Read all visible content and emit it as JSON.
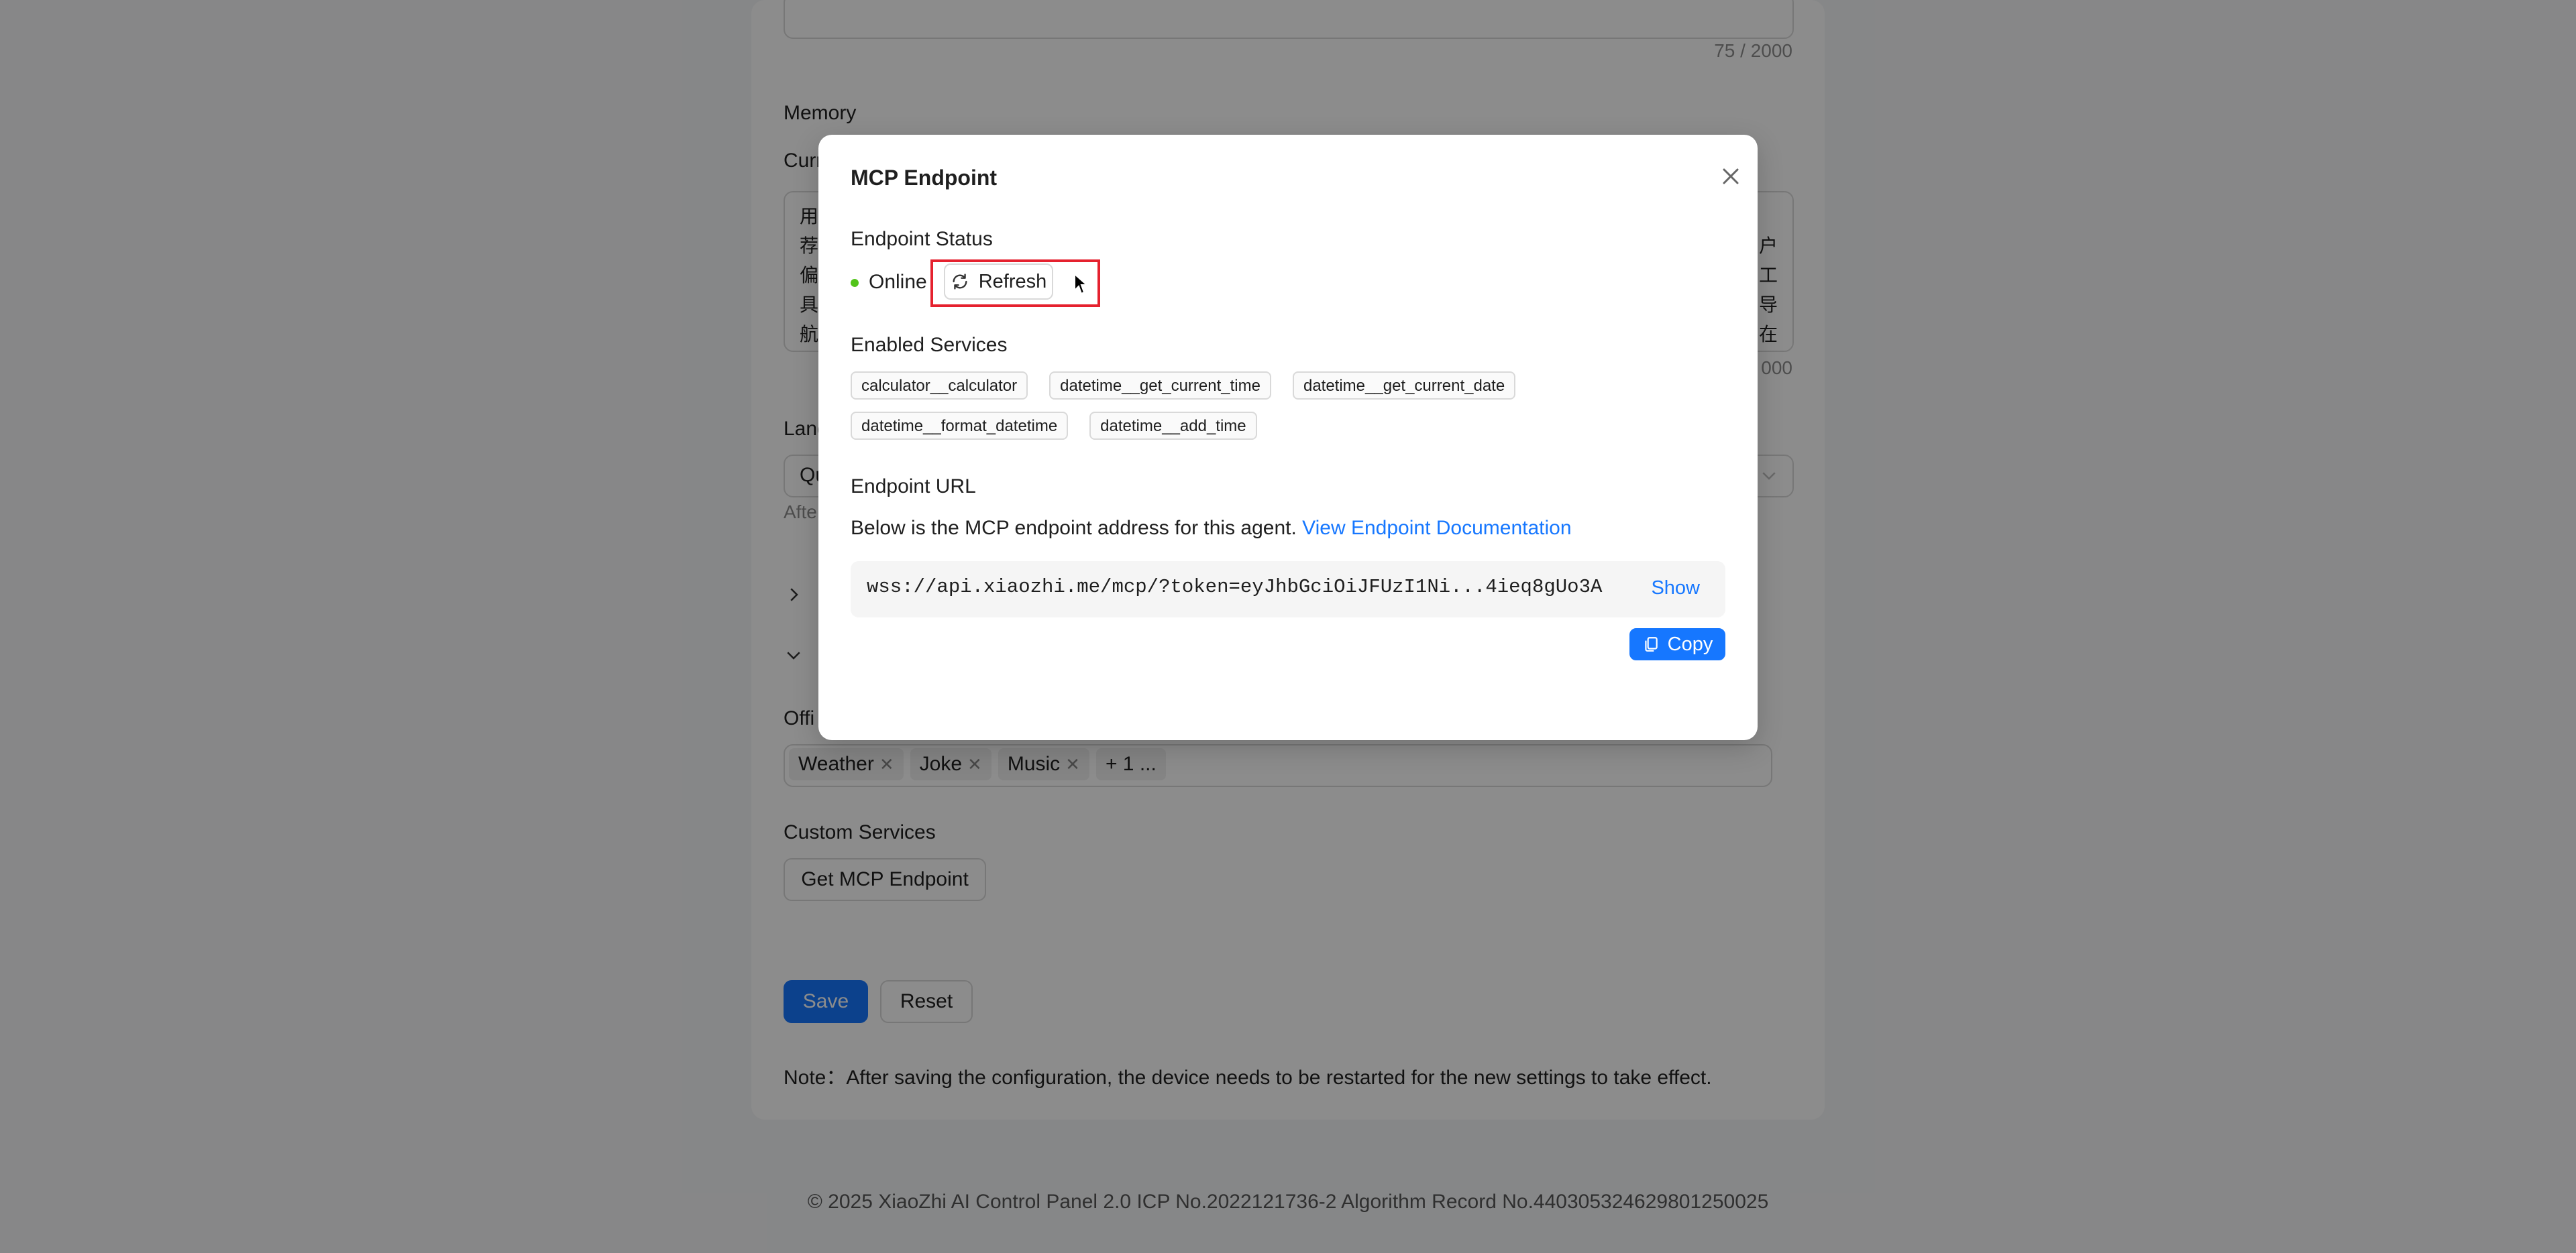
{
  "background": {
    "counter_top": "75 / 2000",
    "memory_label": "Memory",
    "current_label_partial": "Curr",
    "memory_lines_left": [
      "用",
      "荐",
      "偏",
      "具",
      "航"
    ],
    "memory_lines_right": [
      "户",
      "工",
      "导",
      "在"
    ],
    "counter_memory_partial": "000",
    "language_label_partial": "Lang",
    "language_select_partial": "Qu",
    "after_text_partial": "Afte",
    "collapsed_row_chevron": ">",
    "expanded_row_chevron": "v",
    "official_label_partial": "Offi",
    "official_tags": [
      "Weather",
      "Joke",
      "Music"
    ],
    "official_more": "+ 1 ...",
    "custom_services_label": "Custom Services",
    "get_endpoint_button": "Get MCP Endpoint",
    "save_button": "Save",
    "reset_button": "Reset",
    "note": "Note：After saving the configuration, the device needs to be restarted for the new settings to take effect.",
    "footer": "© 2025 XiaoZhi AI Control Panel 2.0 ICP No.2022121736-2 Algorithm Record No.440305324629801250025"
  },
  "modal": {
    "title": "MCP Endpoint",
    "status_label": "Endpoint Status",
    "status_value": "Online",
    "refresh_button": "Refresh",
    "services_label": "Enabled Services",
    "services": [
      "calculator__calculator",
      "datetime__get_current_time",
      "datetime__get_current_date",
      "datetime__format_datetime",
      "datetime__add_time"
    ],
    "url_label": "Endpoint URL",
    "url_desc": "Below is the MCP endpoint address for this agent.",
    "url_doc_link": "View Endpoint Documentation",
    "url_value": "wss://api.xiaozhi.me/mcp/?token=eyJhbGciOiJFUzI1Ni...4ieq8gUo3A",
    "show_link": "Show",
    "copy_button": "Copy"
  },
  "colors": {
    "primary": "#1677ff",
    "online_dot": "#52c41a",
    "highlight": "#e5212e"
  }
}
